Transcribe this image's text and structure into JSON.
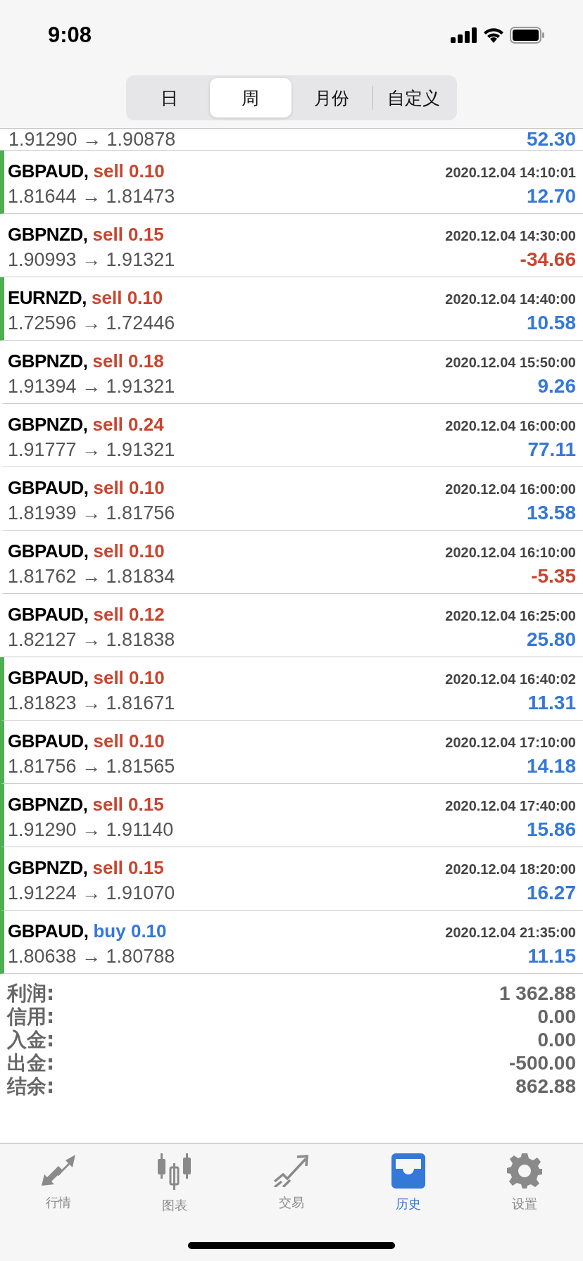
{
  "status_bar": {
    "time": "9:08"
  },
  "period_tabs": [
    {
      "label": "日",
      "selected": false
    },
    {
      "label": "周",
      "selected": true
    },
    {
      "label": "月份",
      "selected": false
    },
    {
      "label": "自定义",
      "selected": false
    }
  ],
  "partial_row": {
    "prices": "1.91290 → 1.90878",
    "profit": "52.30",
    "loss": false
  },
  "trades": [
    {
      "symbol": "GBPAUD,",
      "order": "sell 0.10",
      "kind": "sell",
      "time": "2020.12.04 14:10:01",
      "prices": "1.81644 → 1.81473",
      "profit": "12.70",
      "loss": false,
      "marked": true
    },
    {
      "symbol": "GBPNZD,",
      "order": "sell 0.15",
      "kind": "sell",
      "time": "2020.12.04 14:30:00",
      "prices": "1.90993 → 1.91321",
      "profit": "-34.66",
      "loss": true,
      "marked": false
    },
    {
      "symbol": "EURNZD,",
      "order": "sell 0.10",
      "kind": "sell",
      "time": "2020.12.04 14:40:00",
      "prices": "1.72596 → 1.72446",
      "profit": "10.58",
      "loss": false,
      "marked": true
    },
    {
      "symbol": "GBPNZD,",
      "order": "sell 0.18",
      "kind": "sell",
      "time": "2020.12.04 15:50:00",
      "prices": "1.91394 → 1.91321",
      "profit": "9.26",
      "loss": false,
      "marked": false
    },
    {
      "symbol": "GBPNZD,",
      "order": "sell 0.24",
      "kind": "sell",
      "time": "2020.12.04 16:00:00",
      "prices": "1.91777 → 1.91321",
      "profit": "77.11",
      "loss": false,
      "marked": false
    },
    {
      "symbol": "GBPAUD,",
      "order": "sell 0.10",
      "kind": "sell",
      "time": "2020.12.04 16:00:00",
      "prices": "1.81939 → 1.81756",
      "profit": "13.58",
      "loss": false,
      "marked": false
    },
    {
      "symbol": "GBPAUD,",
      "order": "sell 0.10",
      "kind": "sell",
      "time": "2020.12.04 16:10:00",
      "prices": "1.81762 → 1.81834",
      "profit": "-5.35",
      "loss": true,
      "marked": false
    },
    {
      "symbol": "GBPAUD,",
      "order": "sell 0.12",
      "kind": "sell",
      "time": "2020.12.04 16:25:00",
      "prices": "1.82127 → 1.81838",
      "profit": "25.80",
      "loss": false,
      "marked": false
    },
    {
      "symbol": "GBPAUD,",
      "order": "sell 0.10",
      "kind": "sell",
      "time": "2020.12.04 16:40:02",
      "prices": "1.81823 → 1.81671",
      "profit": "11.31",
      "loss": false,
      "marked": true
    },
    {
      "symbol": "GBPAUD,",
      "order": "sell 0.10",
      "kind": "sell",
      "time": "2020.12.04 17:10:00",
      "prices": "1.81756 → 1.81565",
      "profit": "14.18",
      "loss": false,
      "marked": true
    },
    {
      "symbol": "GBPNZD,",
      "order": "sell 0.15",
      "kind": "sell",
      "time": "2020.12.04 17:40:00",
      "prices": "1.91290 → 1.91140",
      "profit": "15.86",
      "loss": false,
      "marked": true
    },
    {
      "symbol": "GBPNZD,",
      "order": "sell 0.15",
      "kind": "sell",
      "time": "2020.12.04 18:20:00",
      "prices": "1.91224 → 1.91070",
      "profit": "16.27",
      "loss": false,
      "marked": true
    },
    {
      "symbol": "GBPAUD,",
      "order": "buy 0.10",
      "kind": "buy",
      "time": "2020.12.04 21:35:00",
      "prices": "1.80638 → 1.80788",
      "profit": "11.15",
      "loss": false,
      "marked": true
    }
  ],
  "summary": [
    {
      "label": "利润:",
      "value": "1 362.88"
    },
    {
      "label": "信用:",
      "value": "0.00"
    },
    {
      "label": "入金:",
      "value": "0.00"
    },
    {
      "label": "出金:",
      "value": "-500.00"
    },
    {
      "label": "结余:",
      "value": "862.88"
    }
  ],
  "tab_bar": [
    {
      "kind": "quotes",
      "label": "行情",
      "selected": false
    },
    {
      "kind": "chart",
      "label": "图表",
      "selected": false
    },
    {
      "kind": "trade",
      "label": "交易",
      "selected": false
    },
    {
      "kind": "history",
      "label": "历史",
      "selected": true
    },
    {
      "kind": "settings",
      "label": "设置",
      "selected": false
    }
  ]
}
